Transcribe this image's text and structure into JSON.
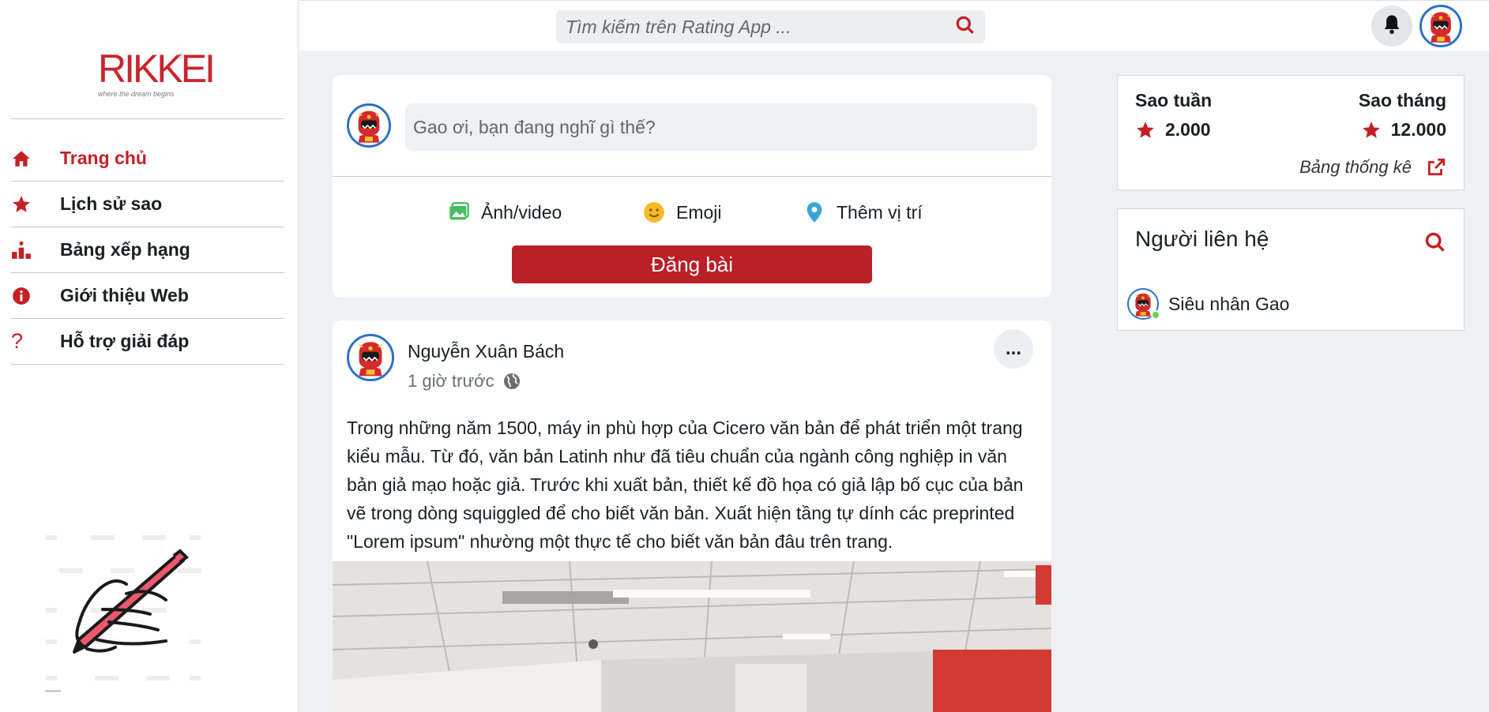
{
  "brand": {
    "logo_text": "RIKKEI",
    "tagline": "where the dream begins",
    "reg_mark": "®"
  },
  "search": {
    "placeholder": "Tìm kiếm trên Rating App ..."
  },
  "sidebar": {
    "items": [
      {
        "label": "Trang chủ",
        "icon": "home-icon",
        "active": true
      },
      {
        "label": "Lịch sử sao",
        "icon": "star-icon"
      },
      {
        "label": "Bảng xếp hạng",
        "icon": "ranking-icon"
      },
      {
        "label": "Giới thiệu Web",
        "icon": "info-icon"
      },
      {
        "label": "Hỗ trợ giải đáp",
        "icon": "question-icon"
      }
    ]
  },
  "composer": {
    "placeholder": "Gao ơi, bạn đang nghĩ gì thế?",
    "actions": [
      {
        "label": "Ảnh/video",
        "icon": "image-icon",
        "color": "#45bd62"
      },
      {
        "label": "Emoji",
        "icon": "emoji-icon",
        "color": "#f7b928"
      },
      {
        "label": "Thêm vị trí",
        "icon": "location-icon",
        "color": "#3aa6d8"
      }
    ],
    "submit_label": "Đăng bài"
  },
  "post": {
    "author": "Nguyễn Xuân Bách",
    "time": "1 giờ trước",
    "more_label": "...",
    "text": "Trong những năm 1500, máy in phù hợp của Cicero văn bản để phát triển một trang kiểu mẫu. Từ đó, văn bản Latinh như đã tiêu chuẩn của ngành công nghiệp in văn bản giả mạo hoặc giả. Trước khi xuất bản, thiết kế đồ họa có giả lập bố cục của bản vẽ trong dòng squiggled để cho biết văn bản. Xuất hiện tầng tự dính các preprinted \"Lorem ipsum\" nhường một thực tế cho biết văn bản đâu trên trang."
  },
  "stats": {
    "week_title": "Sao tuần",
    "week_value": "2.000",
    "month_title": "Sao tháng",
    "month_value": "12.000",
    "link_label": "Bảng thống kê"
  },
  "contacts": {
    "title": "Người liên hệ",
    "items": [
      {
        "name": "Siêu nhân Gao",
        "online": true
      }
    ]
  },
  "colors": {
    "accent": "#c42127",
    "avatar_ring": "#2a71c8",
    "background": "#eef0f3",
    "online": "#6bd04a"
  }
}
